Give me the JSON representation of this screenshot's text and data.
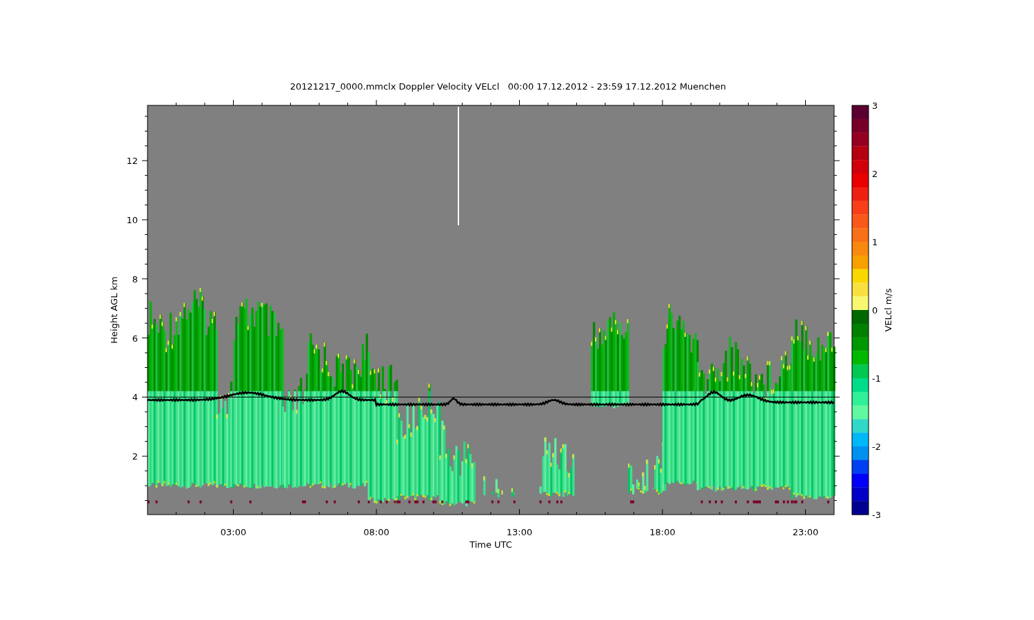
{
  "title": "20121217_0000.mmclx Doppler Velocity VELcl   00:00 17.12.2012 - 23:59 17.12.2012 Muenchen",
  "plot": {
    "ylabel": "Height AGL km",
    "xlabel": "Time UTC",
    "yticks": [
      "12",
      "10",
      "8",
      "6",
      "4",
      "2"
    ],
    "xticks": [
      "03:00",
      "08:00",
      "13:00",
      "18:00",
      "23:00"
    ]
  },
  "colorbar": {
    "label": "VELcl m/s",
    "ticks": [
      "3",
      "2",
      "1",
      "0",
      "-1",
      "-2",
      "-3"
    ],
    "segments": [
      {
        "color": "#5a0030"
      },
      {
        "color": "#780028"
      },
      {
        "color": "#960020"
      },
      {
        "color": "#b40010"
      },
      {
        "color": "#d20008"
      },
      {
        "color": "#e80000"
      },
      {
        "color": "#f02010"
      },
      {
        "color": "#f84018"
      },
      {
        "color": "#f85818"
      },
      {
        "color": "#f87018"
      },
      {
        "color": "#f88810"
      },
      {
        "color": "#f8a000"
      },
      {
        "color": "#f8d800"
      },
      {
        "color": "#f8e040"
      },
      {
        "color": "#f8f870"
      },
      {
        "color": "#006800"
      },
      {
        "color": "#008000"
      },
      {
        "color": "#009800"
      },
      {
        "color": "#00b800"
      },
      {
        "color": "#00c850"
      },
      {
        "color": "#00dc88"
      },
      {
        "color": "#30f098"
      },
      {
        "color": "#60f8a0"
      },
      {
        "color": "#30d8c8"
      },
      {
        "color": "#00b8f8"
      },
      {
        "color": "#0090f0"
      },
      {
        "color": "#0040f0"
      },
      {
        "color": "#0000f8"
      },
      {
        "color": "#0000c8"
      },
      {
        "color": "#000090"
      }
    ]
  }
}
